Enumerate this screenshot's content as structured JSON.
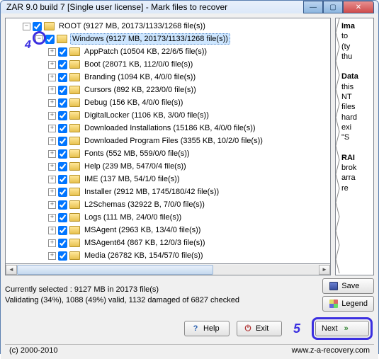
{
  "window": {
    "title": "ZAR 9.0 build 7 [Single user license] - Mark files to recover"
  },
  "tree": {
    "root": {
      "label": "ROOT (9127 MB, 20173/1133/1268 file(s))",
      "indent": 24,
      "exp": "−"
    },
    "selected": {
      "label": "Windows (9127 MB, 20173/1133/1268 file(s))",
      "indent": 42,
      "exp": "−"
    },
    "children": [
      {
        "label": "AppPatch (10504 KB, 22/6/5 file(s))"
      },
      {
        "label": "Boot (28071 KB, 112/0/0 file(s))"
      },
      {
        "label": "Branding (1094 KB, 4/0/0 file(s))"
      },
      {
        "label": "Cursors (892 KB, 223/0/0 file(s))"
      },
      {
        "label": "Debug (156 KB, 4/0/0 file(s))"
      },
      {
        "label": "DigitalLocker (1106 KB, 3/0/0 file(s))"
      },
      {
        "label": "Downloaded Installations (15186 KB, 4/0/0 file(s))"
      },
      {
        "label": "Downloaded Program Files (3355 KB, 10/2/0 file(s))"
      },
      {
        "label": "Fonts (552 MB, 559/0/0 file(s))"
      },
      {
        "label": "Help (239 MB, 547/0/4 file(s))"
      },
      {
        "label": "IME (137 MB, 54/1/0 file(s))"
      },
      {
        "label": "Installer (2912 MB, 1745/180/42 file(s))"
      },
      {
        "label": "L2Schemas (32922 B, 7/0/0 file(s))"
      },
      {
        "label": "Logs (111 MB, 24/0/0 file(s))"
      },
      {
        "label": "MSAgent (2963 KB, 13/4/0 file(s))"
      },
      {
        "label": "MSAgent64 (867 KB, 12/0/3 file(s))"
      },
      {
        "label": "Media (26782 KB, 154/57/0 file(s))"
      }
    ],
    "child_indent": 60,
    "child_exp": "+"
  },
  "side": {
    "h1": "Ima",
    "l1": "to",
    "l2": "(ty",
    "l3": "thu",
    "h2": "Data",
    "l4": "this",
    "l5": "NT",
    "l6": "files",
    "l7": "hard",
    "l8": "exi",
    "l9": "\"S",
    "h3": "RAI",
    "l10": "brok",
    "l11": "arra",
    "l12": "re"
  },
  "status": {
    "line1": "Currently selected : 9127 MB in 20173 file(s)",
    "line2": "Validating (34%), 1088 (49%)  valid, 1132 damaged of 6827 checked"
  },
  "buttons": {
    "save": "Save",
    "legend": "Legend",
    "help": "Help",
    "exit": "Exit",
    "next": "Next"
  },
  "footer": {
    "copyright": "(c) 2000-2010",
    "url": "www.z-a-recovery.com"
  },
  "markers": {
    "four": "4",
    "five": "5"
  }
}
